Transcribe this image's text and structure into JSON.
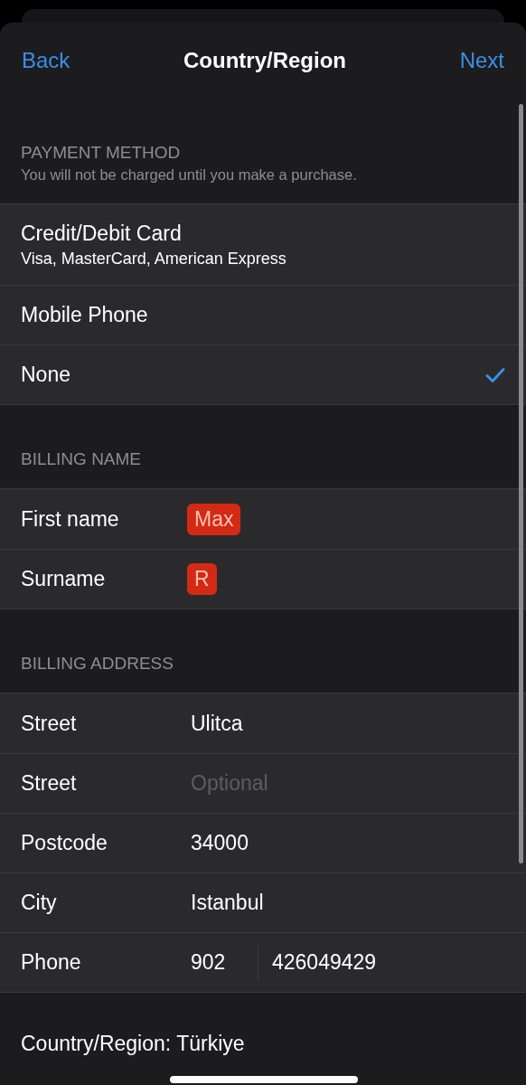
{
  "navigation": {
    "back": "Back",
    "title": "Country/Region",
    "next": "Next"
  },
  "sections": [
    {
      "header": "PAYMENT METHOD",
      "subtitle": "You will not be charged until you make a purchase.",
      "rows": [
        {
          "kind": "option",
          "label": "Credit/Debit Card",
          "detail": "Visa, MasterCard, American Express",
          "selected": false
        },
        {
          "kind": "option",
          "label": "Mobile Phone",
          "selected": false
        },
        {
          "kind": "option",
          "label": "None",
          "selected": true
        }
      ]
    },
    {
      "header": "BILLING NAME",
      "rows": [
        {
          "kind": "redacted",
          "label": "First name",
          "value": "Max"
        },
        {
          "kind": "redacted",
          "label": "Surname",
          "value": "R"
        }
      ]
    },
    {
      "header": "BILLING ADDRESS",
      "rows": [
        {
          "kind": "field",
          "label": "Street",
          "value": "Ulitca"
        },
        {
          "kind": "field",
          "label": "Street",
          "placeholder": "Optional"
        },
        {
          "kind": "field",
          "label": "Postcode",
          "value": "34000"
        },
        {
          "kind": "field",
          "label": "City",
          "value": "Istanbul"
        },
        {
          "kind": "phone",
          "label": "Phone",
          "code": "902",
          "number": "426049429"
        }
      ]
    }
  ],
  "footer": "Country/Region: Türkiye"
}
